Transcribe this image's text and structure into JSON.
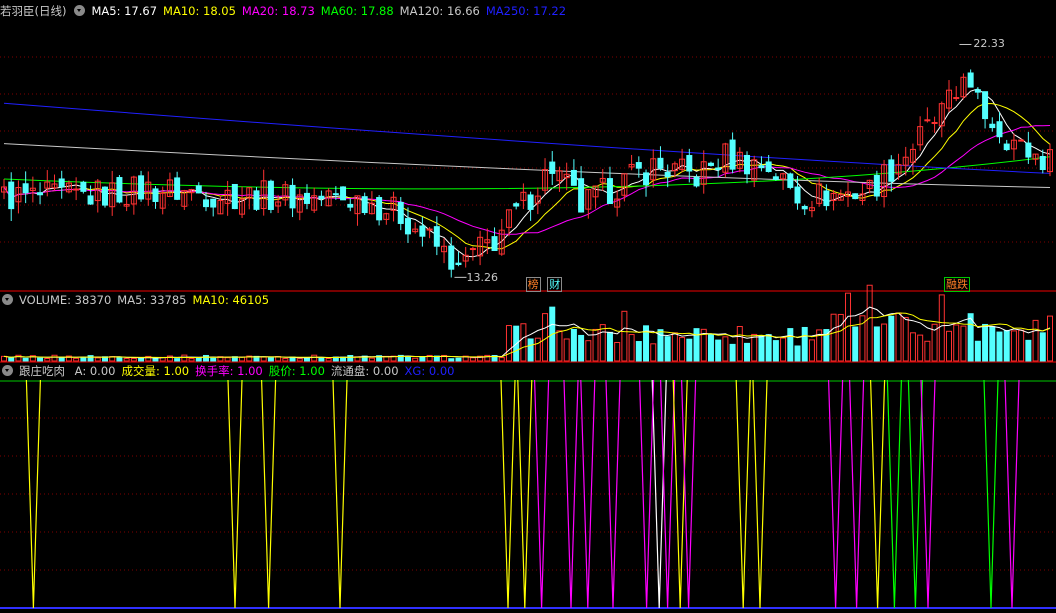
{
  "header": {
    "stock_name": "若羽臣(日线)",
    "ma": [
      {
        "label": "MA5: 17.67",
        "color": "#ffffff"
      },
      {
        "label": "MA10: 18.05",
        "color": "#ffff00"
      },
      {
        "label": "MA20: 18.73",
        "color": "#ff00ff"
      },
      {
        "label": "MA60: 17.88",
        "color": "#00ff00"
      },
      {
        "label": "MA120: 16.66",
        "color": "#c8c8c8"
      },
      {
        "label": "MA250: 17.22",
        "color": "#2020ff"
      }
    ]
  },
  "volume_header": {
    "items": [
      {
        "label": "VOLUME: 38370",
        "color": "#c8c8c8"
      },
      {
        "label": "MA5: 33785",
        "color": "#c8c8c8"
      },
      {
        "label": "MA10: 46105",
        "color": "#ffff00"
      }
    ]
  },
  "indicator_header": {
    "name": "跟庄吃肉",
    "items": [
      {
        "label": "A: 0.00",
        "color": "#c8c8c8"
      },
      {
        "label": "成交量: 1.00",
        "color": "#ffff00"
      },
      {
        "label": "换手率: 1.00",
        "color": "#ff00ff"
      },
      {
        "label": "股价: 1.00",
        "color": "#00ff00"
      },
      {
        "label": "流通盘: 0.00",
        "color": "#c8c8c8"
      },
      {
        "label": "XG: 0.00",
        "color": "#2020ff"
      }
    ]
  },
  "annotations": {
    "max_label": "22.33",
    "min_label": "13.26",
    "tags": [
      {
        "text": "榜",
        "index": 73
      },
      {
        "text": "财",
        "index": 76
      },
      {
        "text": "融跌",
        "index": 131
      }
    ]
  },
  "colors": {
    "up": "#ff3232",
    "down": "#54ffff",
    "grid": "#800000",
    "frame": "#c00000"
  },
  "chart_data": [
    {
      "type": "candlestick",
      "title": "",
      "price_range": [
        12.6,
        23.3
      ],
      "ma_series": [
        {
          "name": "MA5",
          "start": [
            0,
            16.4
          ],
          "end": [
            145,
            17.67
          ]
        },
        {
          "name": "MA10",
          "start": [
            0,
            16.3
          ],
          "end": [
            145,
            18.05
          ]
        },
        {
          "name": "MA20",
          "start": [
            0,
            16.3
          ],
          "end": [
            145,
            18.73
          ]
        },
        {
          "name": "MA60",
          "start": [
            0,
            17.0
          ],
          "end": [
            145,
            17.88
          ]
        },
        {
          "name": "MA120",
          "start": [
            0,
            18.4
          ],
          "end": [
            145,
            16.66
          ]
        },
        {
          "name": "MA250",
          "start": [
            0,
            20.0
          ],
          "end": [
            145,
            17.22
          ]
        }
      ],
      "max": {
        "index": 133,
        "value": 22.33
      },
      "min": {
        "index": 63,
        "value": 13.26
      }
    },
    {
      "type": "bar",
      "title": "VOLUME",
      "last_value": 38370,
      "ma5": 33785,
      "ma10": 46105,
      "ylim": [
        0,
        47000
      ]
    },
    {
      "type": "line",
      "title": "跟庄吃肉",
      "series": [
        "成交量",
        "换手率",
        "股价"
      ],
      "ylim": [
        0,
        1
      ]
    }
  ]
}
